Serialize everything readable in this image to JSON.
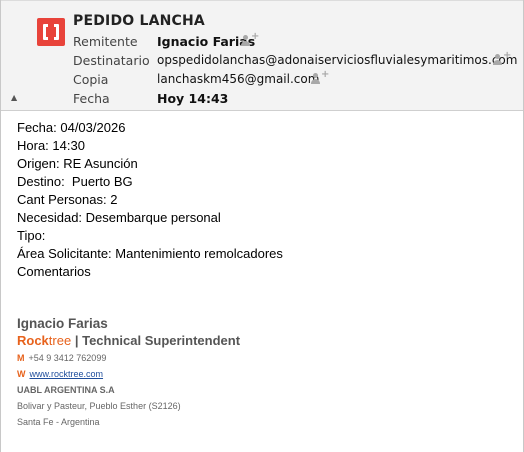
{
  "header": {
    "subject": "PEDIDO LANCHA",
    "fields": [
      {
        "label": "Remitente",
        "value": "Ignacio Farias"
      },
      {
        "label": "Destinatario",
        "value": "opspedidolanchas@adonaiserviciosfluvialesymaritimos.com"
      },
      {
        "label": "Copia",
        "value": "lanchaskm456@gmail.com"
      },
      {
        "label": "Fecha",
        "value": "Hoy 14:43"
      }
    ],
    "collapse_glyph": "▲"
  },
  "body": {
    "lines": [
      "Fecha: 04/03/2026",
      "Hora: 14:30",
      "Origen: RE Asunción",
      "Destino:  Puerto BG",
      "Cant Personas: 2",
      "Necesidad: Desembarque personal",
      "Tipo:",
      "Área Solicitante: Mantenimiento remolcadores",
      "Comentarios"
    ]
  },
  "signature": {
    "name": "Ignacio Farias",
    "company_rock": "Rock",
    "company_tree": "tree",
    "separator": "|",
    "title": "Technical Superintendent",
    "mobile_label": "M",
    "mobile": "+54 9 3412 762099",
    "web_label": "W",
    "web": "www.rocktree.com",
    "org": "UABL ARGENTINA S.A",
    "address1": "Bolivar y Pasteur, Pueblo Esther (S2126)",
    "address2": "Santa Fe - Argentina"
  },
  "icons": {
    "app_logo": "mail-app-logo-icon",
    "add_contact": "add-contact-icon"
  },
  "colors": {
    "logo_red": "#e8433a",
    "brand_orange": "#e7621c",
    "link_blue": "#1f4e9c"
  }
}
